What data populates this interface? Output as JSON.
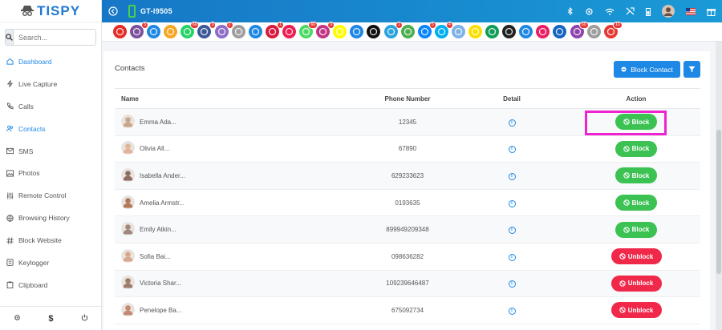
{
  "app": {
    "brand": "TISPY",
    "device": "GT-I9505"
  },
  "search": {
    "placeholder": "Search..."
  },
  "sidebar": {
    "items": [
      {
        "label": "Dashboard",
        "icon": "home-icon",
        "active": true
      },
      {
        "label": "Live Capture",
        "icon": "bolt-icon",
        "active": false
      },
      {
        "label": "Calls",
        "icon": "phone-icon",
        "active": false
      },
      {
        "label": "Contacts",
        "icon": "users-icon",
        "active": true
      },
      {
        "label": "SMS",
        "icon": "mail-icon",
        "active": false
      },
      {
        "label": "Photos",
        "icon": "image-icon",
        "active": false
      },
      {
        "label": "Remote Control",
        "icon": "sliders-icon",
        "active": false
      },
      {
        "label": "Browsing History",
        "icon": "globe-icon",
        "active": false
      },
      {
        "label": "Block Website",
        "icon": "hash-icon",
        "active": false
      },
      {
        "label": "Keylogger",
        "icon": "keyboard-icon",
        "active": false
      },
      {
        "label": "Clipboard",
        "icon": "clipboard-icon",
        "active": false
      }
    ],
    "bottom": [
      "settings-icon",
      "dollar-icon",
      "power-icon"
    ]
  },
  "app_icons": [
    {
      "name": "youtube",
      "color": "#e52d27",
      "badge": ""
    },
    {
      "name": "viber",
      "color": "#7b519d",
      "badge": "5"
    },
    {
      "name": "email",
      "color": "#1e88e5",
      "badge": ""
    },
    {
      "name": "copy",
      "color": "#f5a623",
      "badge": ""
    },
    {
      "name": "whatsapp",
      "color": "#25d366",
      "badge": "66"
    },
    {
      "name": "facebook",
      "color": "#3b5998",
      "badge": "9"
    },
    {
      "name": "viber2",
      "color": "#8e6cc9",
      "badge": "2"
    },
    {
      "name": "clipboard",
      "color": "#9e9e9e",
      "badge": ""
    },
    {
      "name": "screen",
      "color": "#1e88e5",
      "badge": ""
    },
    {
      "name": "tiktok-red",
      "color": "#d81b3c",
      "badge": "1"
    },
    {
      "name": "tiktok",
      "color": "#ee1d52",
      "badge": ""
    },
    {
      "name": "line",
      "color": "#4cd964",
      "badge": "66"
    },
    {
      "name": "instagram",
      "color": "#c13584",
      "badge": "9"
    },
    {
      "name": "snapchat",
      "color": "#fffc00",
      "badge": ""
    },
    {
      "name": "dots",
      "color": "#1e88e5",
      "badge": ""
    },
    {
      "name": "tiktok-black",
      "color": "#111111",
      "badge": ""
    },
    {
      "name": "telegram",
      "color": "#2aa3df",
      "badge": "1"
    },
    {
      "name": "imo",
      "color": "#4caf50",
      "badge": ""
    },
    {
      "name": "messenger",
      "color": "#0a84ff",
      "badge": "5"
    },
    {
      "name": "skype",
      "color": "#00aff0",
      "badge": "4"
    },
    {
      "name": "zalo",
      "color": "#7fb3e8",
      "badge": ""
    },
    {
      "name": "kakao",
      "color": "#f9e000",
      "badge": ""
    },
    {
      "name": "hangouts",
      "color": "#0f9d58",
      "badge": ""
    },
    {
      "name": "kik",
      "color": "#222222",
      "badge": ""
    },
    {
      "name": "tablet",
      "color": "#1e88e5",
      "badge": ""
    },
    {
      "name": "video",
      "color": "#e91e63",
      "badge": ""
    },
    {
      "name": "n-app",
      "color": "#1565c0",
      "badge": ""
    },
    {
      "name": "signal",
      "color": "#8e44ad",
      "badge": "60"
    },
    {
      "name": "gray-app",
      "color": "#9e9e9e",
      "badge": ""
    },
    {
      "name": "gallery",
      "color": "#e53935",
      "badge": "10"
    }
  ],
  "contacts": {
    "title": "Contacts",
    "block_contact_label": "Block Contact",
    "columns": [
      "Name",
      "Phone Number",
      "Detail",
      "Action"
    ],
    "rows": [
      {
        "name": "Emma Ada...",
        "phone": "12345",
        "action": "Block"
      },
      {
        "name": "Olivia All...",
        "phone": "67890",
        "action": "Block"
      },
      {
        "name": "Isabella Ander...",
        "phone": "629233623",
        "action": "Block"
      },
      {
        "name": "Amelia Armstr...",
        "phone": "0193635",
        "action": "Block"
      },
      {
        "name": "Emily Atkin...",
        "phone": "899949209348",
        "action": "Block"
      },
      {
        "name": "Sofia Bai...",
        "phone": "098636282",
        "action": "Unblock"
      },
      {
        "name": "Victoria Shar...",
        "phone": "109239646487",
        "action": "Unblock"
      },
      {
        "name": "Penelope Ba...",
        "phone": "675092734",
        "action": "Unblock"
      }
    ]
  }
}
